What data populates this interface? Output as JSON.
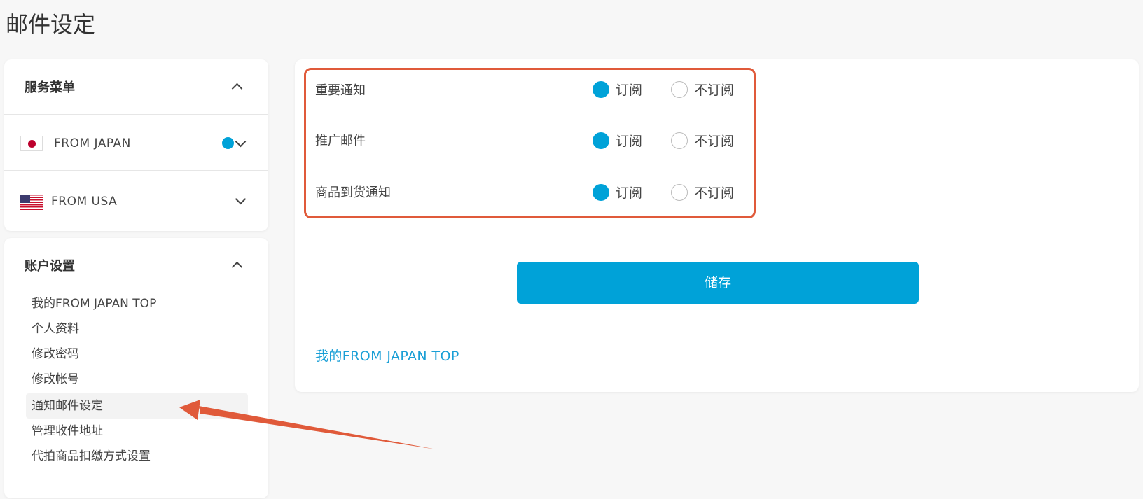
{
  "page": {
    "title": "邮件设定"
  },
  "service_menu": {
    "header": "服务菜单",
    "items": [
      {
        "label": "FROM JAPAN",
        "flag": "japan-flag",
        "selected": true
      },
      {
        "label": "FROM USA",
        "flag": "usa-flag",
        "selected": false
      }
    ]
  },
  "account_settings": {
    "header": "账户设置",
    "items": [
      {
        "label": "我的FROM JAPAN TOP"
      },
      {
        "label": "个人资料"
      },
      {
        "label": "修改密码"
      },
      {
        "label": "修改帐号"
      },
      {
        "label": "通知邮件设定",
        "active": true
      },
      {
        "label": "管理收件地址"
      },
      {
        "label": "代拍商品扣缴方式设置"
      }
    ]
  },
  "mail_settings": {
    "rows": [
      {
        "label": "重要通知",
        "subscribe_label": "订阅",
        "unsubscribe_label": "不订阅",
        "value": "subscribe"
      },
      {
        "label": "推广邮件",
        "subscribe_label": "订阅",
        "unsubscribe_label": "不订阅",
        "value": "subscribe"
      },
      {
        "label": "商品到货通知",
        "subscribe_label": "订阅",
        "unsubscribe_label": "不订阅",
        "value": "subscribe"
      }
    ],
    "save_label": "储存",
    "bottom_link": "我的FROM JAPAN TOP"
  },
  "colors": {
    "accent": "#00a2d8",
    "highlight_box": "#e05a3a",
    "link": "#1a9fd6"
  }
}
